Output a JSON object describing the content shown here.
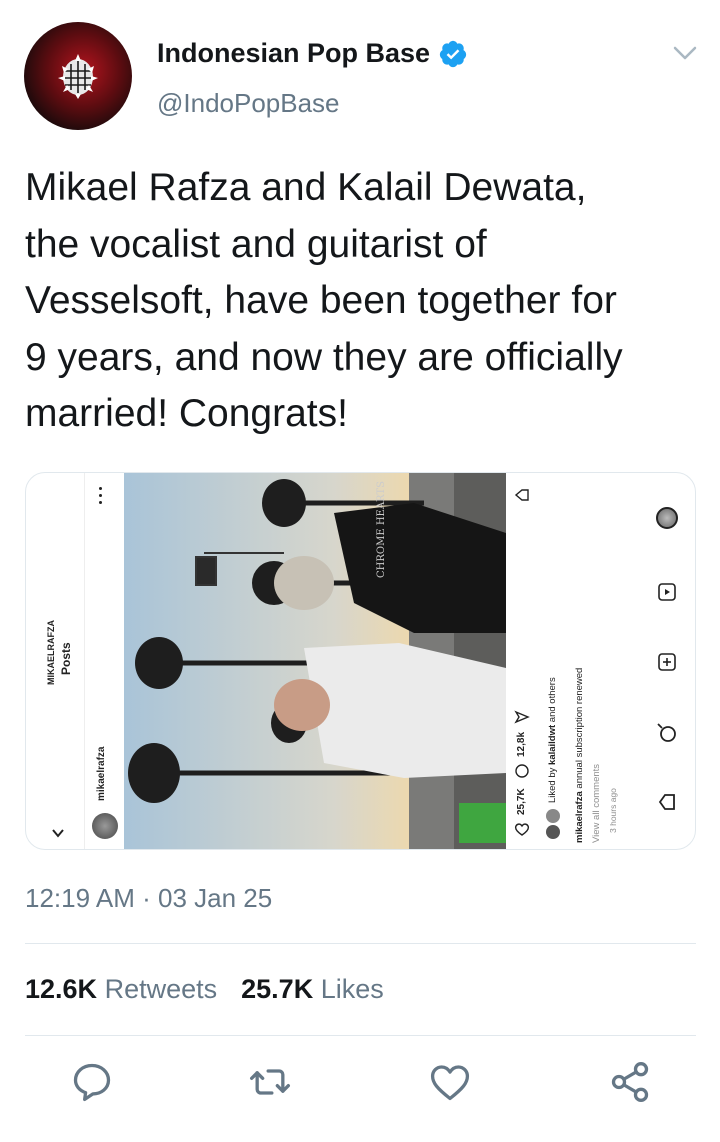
{
  "author": {
    "display_name": "Indonesian Pop Base",
    "handle": "@IndoPopBase",
    "verified": true
  },
  "tweet": {
    "text": "Mikael Rafza and Kalail Dewata, the vocalist and guitarist of Vesselsoft, have been together for 9 years, and now they are officially married! Congrats!",
    "lines": [
      "Mikael Rafza and Kalail Dewata,",
      "the vocalist and guitarist of",
      "Vesselsoft, have been together for",
      "9 years, and now they are officially",
      "married! Congrats!"
    ],
    "time": "12:19 AM",
    "separator": "·",
    "date": "03 Jan 25"
  },
  "stats": {
    "retweets_count": "12.6K",
    "retweets_label": "Retweets",
    "likes_count": "25.7K",
    "likes_label": "Likes"
  },
  "embedded_post": {
    "header_title": "MIKAELRAFZA",
    "header_subtitle": "Posts",
    "username": "mikaelrafza",
    "likes": "25,7K",
    "comments": "12,8k",
    "liked_by_prefix": "Liked by",
    "liked_by_user": "kalaildwt",
    "liked_by_suffix": "and others",
    "caption_user": "mikaelrafza",
    "caption_text": "annual subscription renewed",
    "view_comments": "View all comments",
    "posted_ago": "3 hours ago",
    "shirt_text": "CHROME HEARTS"
  },
  "colors": {
    "text": "#14171a",
    "secondary": "#657786",
    "verified": "#1da1f2",
    "border": "#e1e8ed"
  },
  "icons": [
    "verified-badge-icon",
    "chevron-down-icon",
    "reply-icon",
    "retweet-icon",
    "like-icon",
    "share-icon"
  ]
}
